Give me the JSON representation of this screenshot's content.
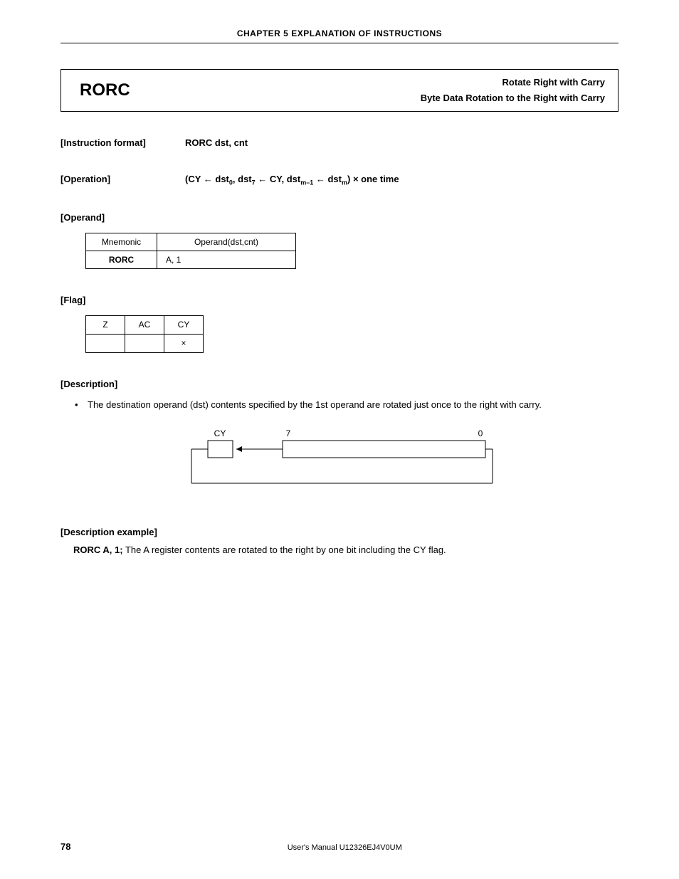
{
  "chapter_header": "CHAPTER 5  EXPLANATION OF INSTRUCTIONS",
  "title": {
    "mnemonic": "RORC",
    "line1": "Rotate Right with Carry",
    "line2": "Byte Data Rotation to the Right with Carry"
  },
  "instruction_format": {
    "label": "[Instruction format]",
    "value": "RORC dst, cnt"
  },
  "operation": {
    "label": "[Operation]",
    "prefix": "(CY ← dst",
    "sub0": "0",
    "mid1": ", dst",
    "sub7": "7",
    "mid2": " ← CY, dst",
    "subm1": "m–1",
    "mid3": " ← dst",
    "subm": "m",
    "suffix": ") × one time"
  },
  "operand": {
    "label": "[Operand]",
    "header_mn": "Mnemonic",
    "header_op": "Operand(dst,cnt)",
    "row_mn": "RORC",
    "row_op": "A, 1"
  },
  "flag": {
    "label": "[Flag]",
    "h_z": "Z",
    "h_ac": "AC",
    "h_cy": "CY",
    "v_z": "",
    "v_ac": "",
    "v_cy": "×"
  },
  "description": {
    "label": "[Description]",
    "bullet": "•",
    "text": "The destination operand (dst) contents specified by the 1st operand are rotated just once to the right with carry."
  },
  "diagram": {
    "cy": "CY",
    "b7": "7",
    "b0": "0"
  },
  "description_example": {
    "label": "[Description example]",
    "cmd": "RORC A, 1;",
    "text": "  The A register contents are rotated to the right by one bit including the CY flag."
  },
  "footer": {
    "page": "78",
    "manual": "User's Manual  U12326EJ4V0UM"
  }
}
